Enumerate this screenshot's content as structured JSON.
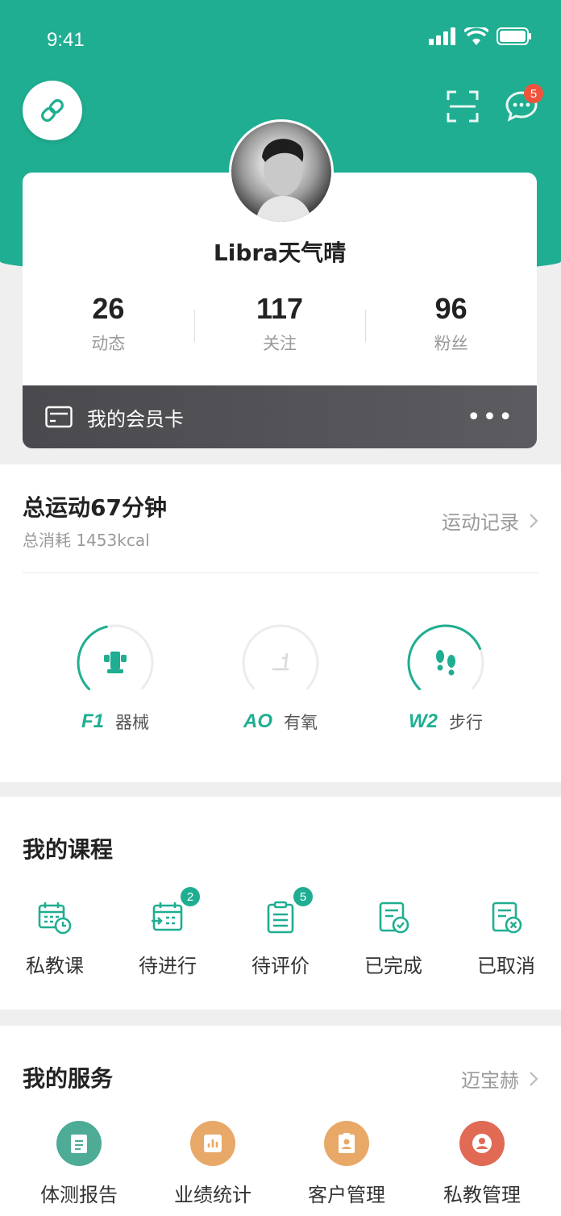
{
  "status_bar": {
    "time": "9:41"
  },
  "header": {
    "message_count": "5"
  },
  "profile": {
    "username": "Libra天气晴",
    "stats": [
      {
        "value": "26",
        "label": "动态"
      },
      {
        "value": "117",
        "label": "关注"
      },
      {
        "value": "96",
        "label": "粉丝"
      }
    ],
    "member_card_label": "我的会员卡",
    "more_label": "•••"
  },
  "sport": {
    "total": "总运动67分钟",
    "kcal": "总消耗 1453kcal",
    "record_link": "运动记录",
    "gauges": [
      {
        "code": "F1",
        "name": "器械",
        "progress": 0.45,
        "active": true,
        "icon": "trophy-icon"
      },
      {
        "code": "AO",
        "name": "有氧",
        "progress": 0.0,
        "active": false,
        "icon": "treadmill-icon"
      },
      {
        "code": "W2",
        "name": "步行",
        "progress": 0.75,
        "active": true,
        "icon": "footprints-icon"
      }
    ]
  },
  "courses": {
    "title": "我的课程",
    "items": [
      {
        "label": "私教课",
        "icon": "calendar-clock-icon",
        "badge": ""
      },
      {
        "label": "待进行",
        "icon": "calendar-arrow-icon",
        "badge": "2"
      },
      {
        "label": "待评价",
        "icon": "clipboard-icon",
        "badge": "5"
      },
      {
        "label": "已完成",
        "icon": "doc-check-icon",
        "badge": ""
      },
      {
        "label": "已取消",
        "icon": "doc-cancel-icon",
        "badge": ""
      }
    ]
  },
  "services": {
    "title": "我的服务",
    "vendor": "迈宝赫",
    "items": [
      {
        "label": "体测报告",
        "icon": "report-icon",
        "color": "#4dab96"
      },
      {
        "label": "业绩统计",
        "icon": "bar-chart-icon",
        "color": "#e8a868"
      },
      {
        "label": "客户管理",
        "icon": "badge-icon",
        "color": "#e8a868"
      },
      {
        "label": "私教管理",
        "icon": "user-icon",
        "color": "#e06a54"
      }
    ]
  },
  "colors": {
    "brand": "#1fae91",
    "badge_red": "#f0533c"
  }
}
